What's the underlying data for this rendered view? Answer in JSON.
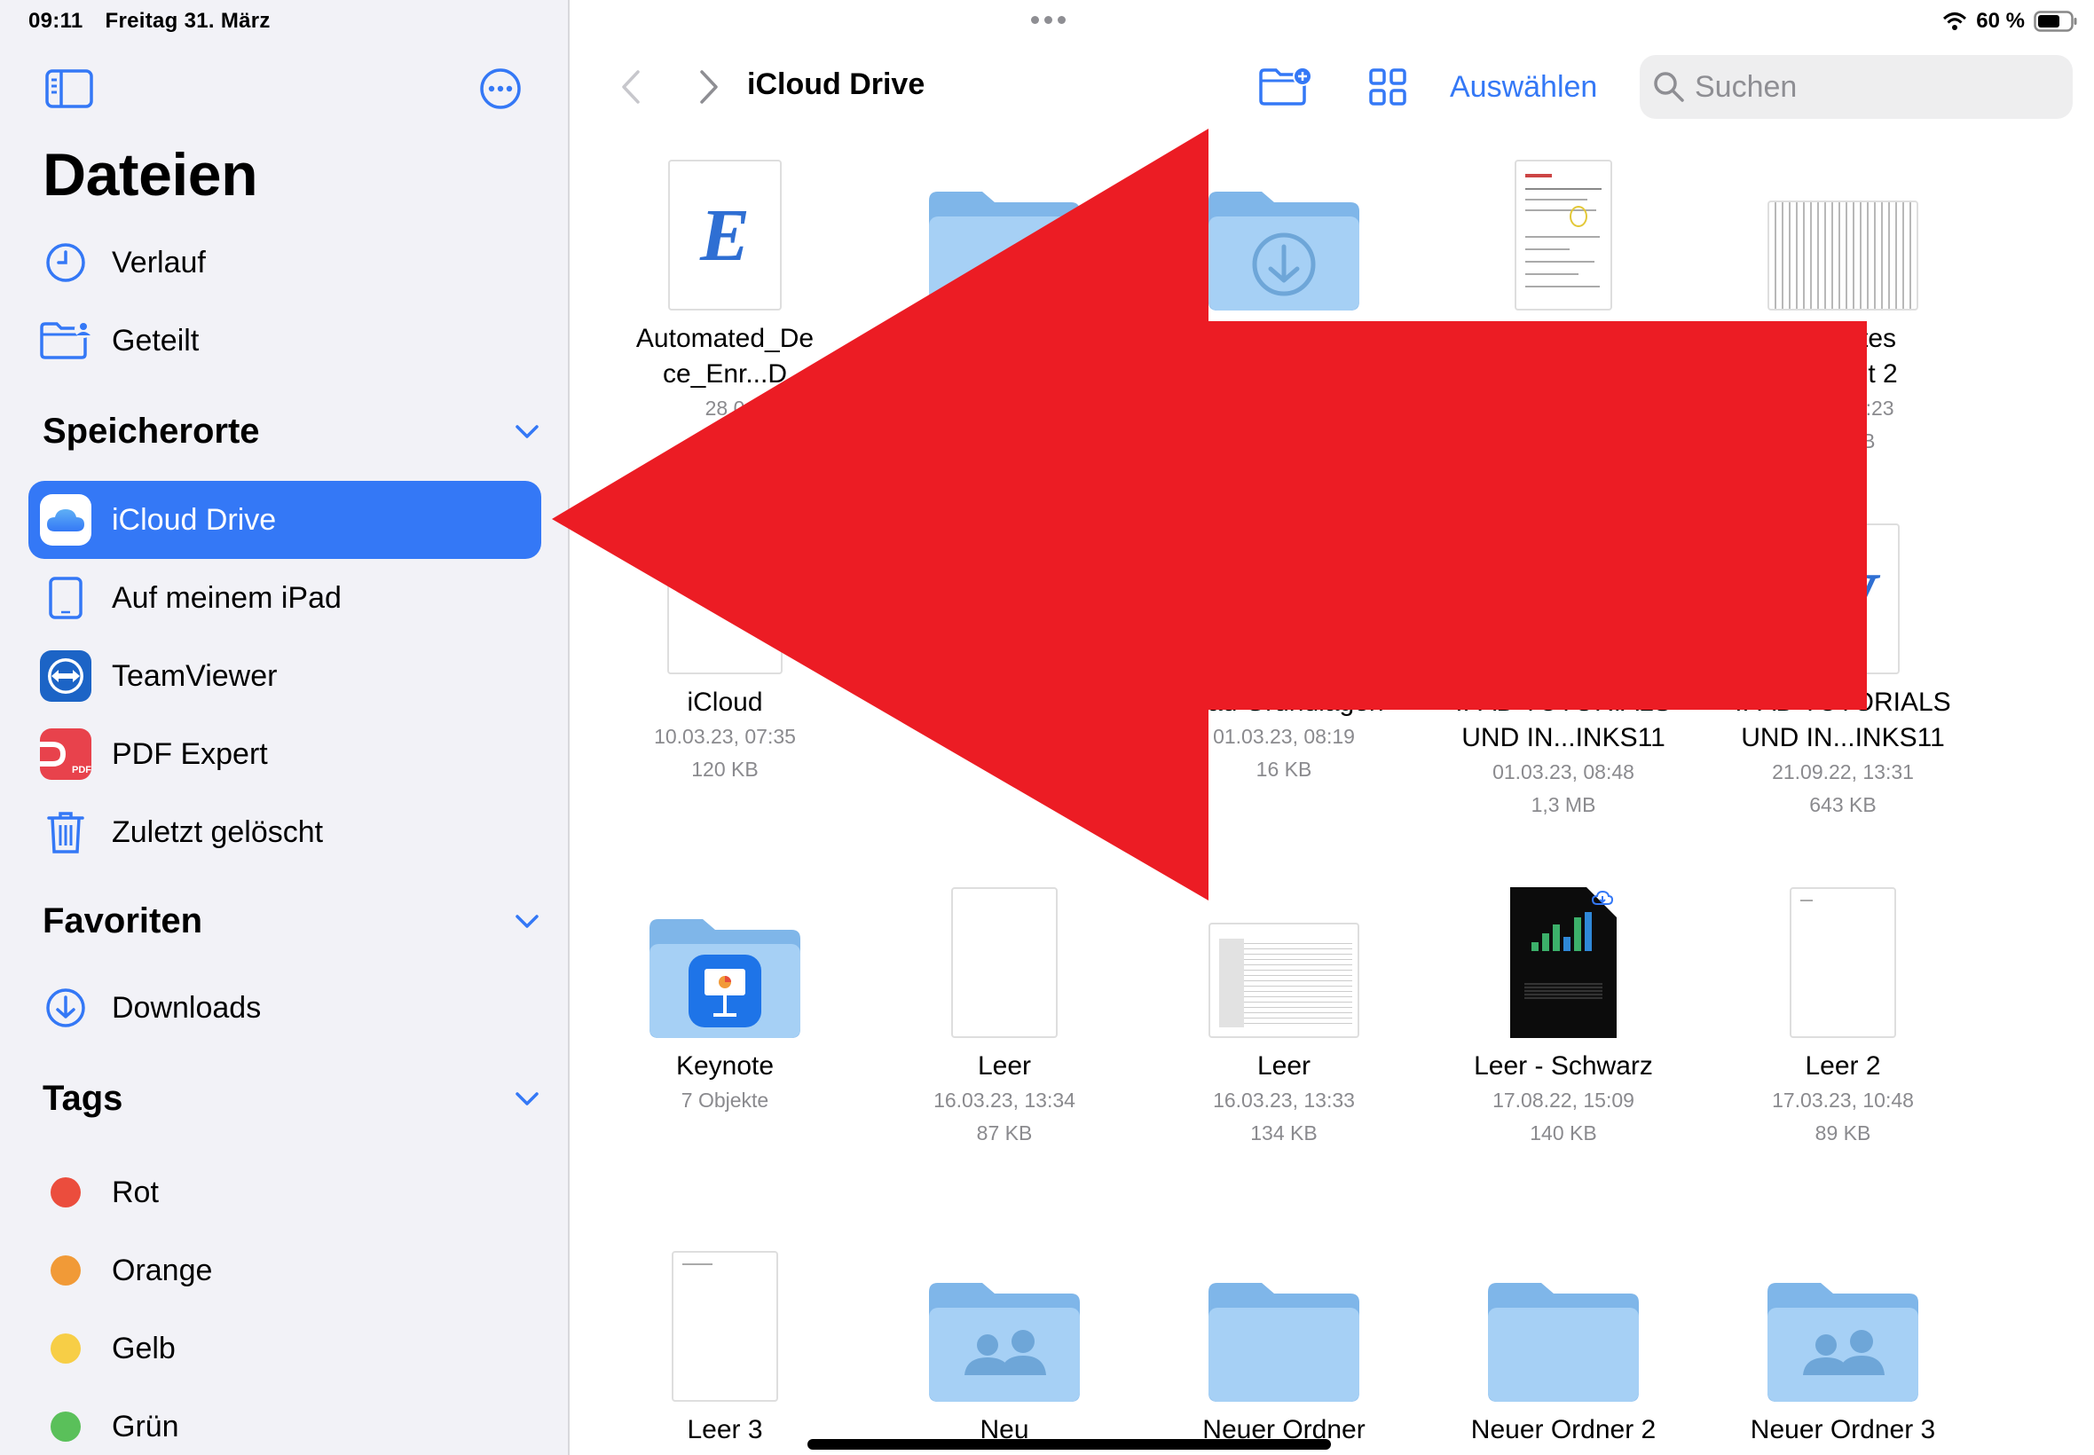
{
  "status": {
    "time": "09:11",
    "date": "Freitag 31. März",
    "battery": "60 %"
  },
  "sidebar": {
    "title": "Dateien",
    "top_items": [
      {
        "label": "Verlauf",
        "icon": "clock-icon"
      },
      {
        "label": "Geteilt",
        "icon": "shared-folder-icon"
      }
    ],
    "locations": {
      "title": "Speicherorte",
      "items": [
        {
          "label": "iCloud Drive",
          "icon": "icloud-icon",
          "active": true
        },
        {
          "label": "Auf meinem iPad",
          "icon": "ipad-icon"
        },
        {
          "label": "TeamViewer",
          "icon": "teamviewer-icon"
        },
        {
          "label": "PDF Expert",
          "icon": "pdf-expert-icon"
        },
        {
          "label": "Zuletzt gelöscht",
          "icon": "trash-icon"
        }
      ]
    },
    "favorites": {
      "title": "Favoriten",
      "items": [
        {
          "label": "Downloads",
          "icon": "download-icon"
        }
      ]
    },
    "tags": {
      "title": "Tags",
      "items": [
        {
          "label": "Rot",
          "color": "#eb4d3d"
        },
        {
          "label": "Orange",
          "color": "#f19a37"
        },
        {
          "label": "Gelb",
          "color": "#f7ce46"
        },
        {
          "label": "Grün",
          "color": "#5ac05a"
        }
      ]
    }
  },
  "main": {
    "title": "iCloud Drive",
    "select_label": "Auswählen",
    "search_placeholder": "Suchen",
    "accent": "#3478f6",
    "items": [
      {
        "name1": "Automated_De",
        "name2": "ce_Enr...D",
        "meta1": "28.0",
        "meta2": ""
      },
      {
        "name1": "",
        "name2": "",
        "meta1": "",
        "meta2": ""
      },
      {
        "name1": "",
        "name2": "",
        "meta1": "",
        "meta2": ""
      },
      {
        "name1": "",
        "name2": "",
        "meta1": "",
        "meta2": ""
      },
      {
        "name1": "scanntes",
        "name2": "kument 2",
        "meta1": "3.23, 10:23",
        "meta2": "5,8 MB"
      },
      {
        "name1": "iCloud",
        "name2": "",
        "meta1": "10.03.23, 07:35",
        "meta2": "120 KB"
      },
      {
        "name1": "",
        "name2": "",
        "meta1": "",
        "meta2": ""
      },
      {
        "name1": "iPad Grundlagen",
        "name2": "",
        "meta1": "01.03.23, 08:19",
        "meta2": "16 KB"
      },
      {
        "name1": "IPAD TUTORIALS",
        "name2": "UND IN...INKS11",
        "meta1": "01.03.23, 08:48",
        "meta2": "1,3 MB"
      },
      {
        "name1": "IPAD TUTORIALS",
        "name2": "UND IN...INKS11",
        "meta1": "21.09.22, 13:31",
        "meta2": "643 KB"
      },
      {
        "name1": "Keynote",
        "name2": "",
        "meta1": "7 Objekte",
        "meta2": ""
      },
      {
        "name1": "Leer",
        "name2": "",
        "meta1": "16.03.23, 13:34",
        "meta2": "87 KB"
      },
      {
        "name1": "Leer",
        "name2": "",
        "meta1": "16.03.23, 13:33",
        "meta2": "134 KB"
      },
      {
        "name1": "Leer - Schwarz",
        "name2": "",
        "meta1": "17.08.22, 15:09",
        "meta2": "140 KB"
      },
      {
        "name1": "Leer 2",
        "name2": "",
        "meta1": "17.03.23, 10:48",
        "meta2": "89 KB"
      },
      {
        "name1": "Leer 3",
        "name2": "",
        "meta1": "",
        "meta2": ""
      },
      {
        "name1": "Neu",
        "name2": "",
        "meta1": "",
        "meta2": ""
      },
      {
        "name1": "Neuer Ordner",
        "name2": "",
        "meta1": "",
        "meta2": ""
      },
      {
        "name1": "Neuer Ordner 2",
        "name2": "",
        "meta1": "",
        "meta2": ""
      },
      {
        "name1": "Neuer Ordner 3",
        "name2": "",
        "meta1": "",
        "meta2": ""
      }
    ]
  },
  "overlay": {
    "arrow_color": "#ec1c24"
  }
}
